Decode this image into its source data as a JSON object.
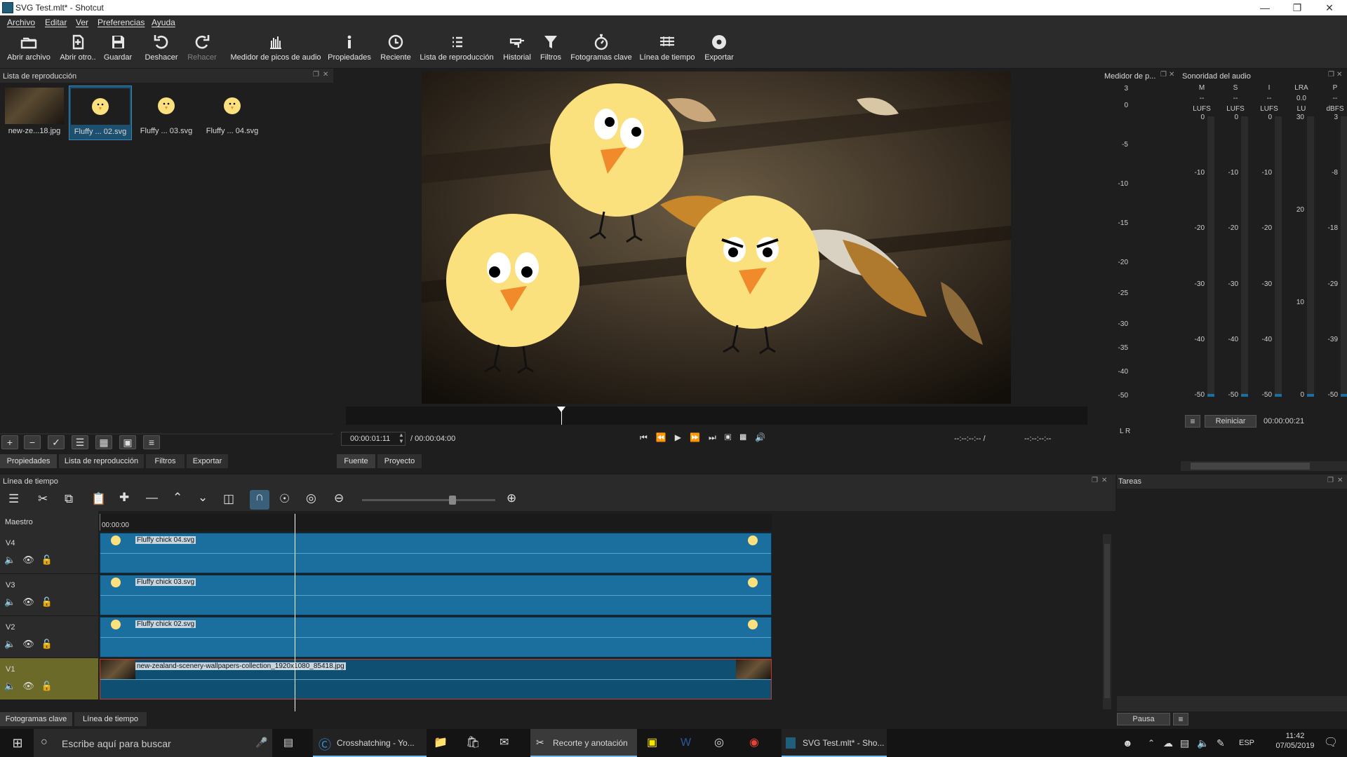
{
  "window": {
    "title": "SVG Test.mlt* - Shotcut"
  },
  "menu": [
    "Archivo",
    "Editar",
    "Ver",
    "Preferencias",
    "Ayuda"
  ],
  "toolbar": [
    {
      "label": "Abrir archivo",
      "icon": "open-file-icon"
    },
    {
      "label": "Abrir otro..",
      "icon": "open-other-icon"
    },
    {
      "label": "Guardar",
      "icon": "save-icon"
    },
    {
      "label": "Deshacer",
      "icon": "undo-icon"
    },
    {
      "label": "Rehacer",
      "icon": "redo-icon"
    },
    {
      "label": "Medidor de picos de audio",
      "icon": "peak-meter-icon"
    },
    {
      "label": "Propiedades",
      "icon": "info-icon"
    },
    {
      "label": "Reciente",
      "icon": "clock-icon"
    },
    {
      "label": "Lista de reproducción",
      "icon": "list-icon"
    },
    {
      "label": "Historial",
      "icon": "history-icon"
    },
    {
      "label": "Filtros",
      "icon": "filter-icon"
    },
    {
      "label": "Fotogramas clave",
      "icon": "stopwatch-icon"
    },
    {
      "label": "Línea de tiempo",
      "icon": "timeline-icon"
    },
    {
      "label": "Exportar",
      "icon": "export-icon"
    }
  ],
  "playlist": {
    "title": "Lista de reproducción",
    "items": [
      {
        "caption": "new-ze...18.jpg",
        "selected": false
      },
      {
        "caption": "Fluffy ... 02.svg",
        "selected": true
      },
      {
        "caption": "Fluffy ... 03.svg",
        "selected": false
      },
      {
        "caption": "Fluffy ... 04.svg",
        "selected": false
      }
    ],
    "tabs": [
      "Propiedades",
      "Lista de reproducción",
      "Filtros",
      "Exportar"
    ]
  },
  "viewer": {
    "current_time": "00:00:01:11",
    "total_time": "/ 00:00:04:00",
    "in_point": "--:--:--:-- /",
    "out_point": "--:--:--:--",
    "tabs": [
      "Fuente",
      "Proyecto"
    ],
    "playhead_fraction": 0.29
  },
  "peak_meter": {
    "title": "Medidor de p...",
    "scale": [
      "3",
      "0",
      "-5",
      "-10",
      "-15",
      "-20",
      "-25",
      "-30",
      "-35",
      "-40",
      "-50"
    ],
    "channels": "L  R"
  },
  "loudness": {
    "title": "Sonoridad del audio",
    "columns": [
      {
        "head": "M",
        "value": "--",
        "unit": "LUFS",
        "scale": [
          "0",
          "-10",
          "-20",
          "-30",
          "-40",
          "-50"
        ]
      },
      {
        "head": "S",
        "value": "--",
        "unit": "LUFS",
        "scale": [
          "0",
          "-10",
          "-20",
          "-30",
          "-40",
          "-50"
        ]
      },
      {
        "head": "I",
        "value": "--",
        "unit": "LUFS",
        "scale": [
          "0",
          "-10",
          "-20",
          "-30",
          "-40",
          "-50"
        ]
      },
      {
        "head": "LRA",
        "value": "0.0",
        "unit": "LU",
        "scale": [
          "30",
          "20",
          "10",
          "0"
        ]
      },
      {
        "head": "P",
        "value": "--",
        "unit": "dBFS",
        "scale": [
          "3",
          "-8",
          "-18",
          "-29",
          "-39",
          "-50"
        ]
      }
    ],
    "reset_label": "Reiniciar",
    "elapsed": "00:00:00:21"
  },
  "timeline": {
    "title": "Línea de tiempo",
    "master_label": "Maestro",
    "ruler_start": "00:00:00",
    "tracks": [
      {
        "name": "V4",
        "clip": "Fluffy chick 04.svg"
      },
      {
        "name": "V3",
        "clip": "Fluffy chick 03.svg"
      },
      {
        "name": "V2",
        "clip": "Fluffy chick 02.svg"
      },
      {
        "name": "V1",
        "clip": "new-zealand-scenery-wallpapers-collection_1920x1080_85418.jpg"
      }
    ],
    "bottom_tabs": [
      "Fotogramas clave",
      "Línea de tiempo"
    ]
  },
  "tasks": {
    "title": "Tareas",
    "pause_label": "Pausa"
  },
  "taskbar": {
    "search_placeholder": "Escribe aquí para buscar",
    "apps": [
      "Crosshatching - Yo...",
      "Recorte y anotación",
      "SVG Test.mlt* - Sho..."
    ],
    "lang": "ESP",
    "time": "11:42",
    "date": "07/05/2019"
  }
}
